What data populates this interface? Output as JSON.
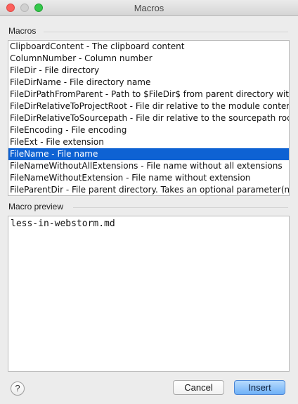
{
  "window": {
    "title": "Macros"
  },
  "macros_section": {
    "label": "Macros"
  },
  "macros": [
    "ClipboardContent - The clipboard content",
    "ColumnNumber - Column number",
    "FileDir - File directory",
    "FileDirName - File directory name",
    "FileDirPathFromParent - Path to $FileDir$ from parent directory with",
    "FileDirRelativeToProjectRoot - File dir relative to the module content",
    "FileDirRelativeToSourcepath - File dir relative to the sourcepath root",
    "FileEncoding - File encoding",
    "FileExt - File extension",
    "FileName - File name",
    "FileNameWithoutAllExtensions - File name without all extensions",
    "FileNameWithoutExtension - File name without extension",
    "FileParentDir - File parent directory. Takes an optional parameter(na"
  ],
  "selected_macro": "FileName - File name",
  "preview_section": {
    "label": "Macro preview"
  },
  "preview": {
    "value": "less-in-webstorm.md"
  },
  "buttons": {
    "help": "?",
    "cancel": "Cancel",
    "insert": "Insert"
  },
  "colors": {
    "selection": "#0e62d3",
    "default_button": "#6fb1f7"
  }
}
